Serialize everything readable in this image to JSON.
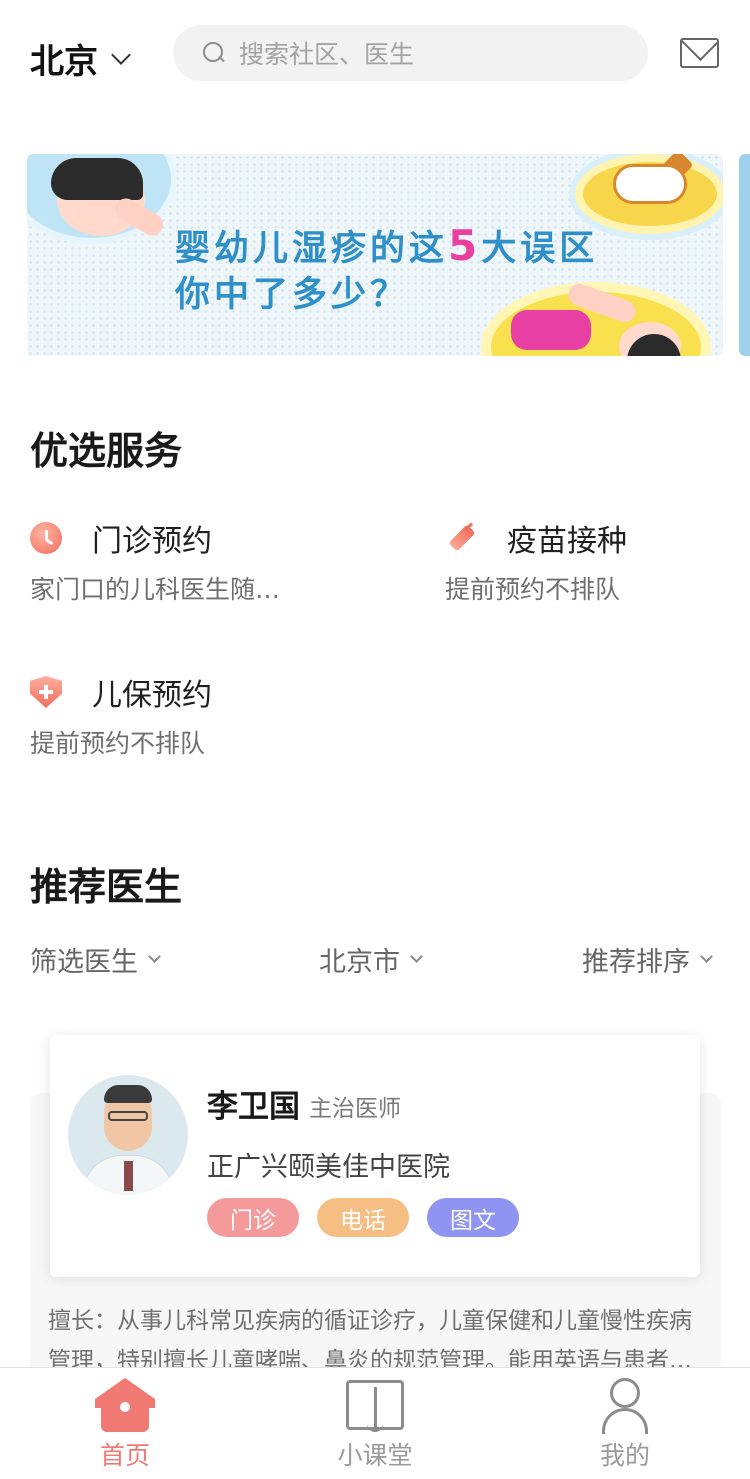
{
  "header": {
    "city": "北京",
    "search_placeholder": "搜索社区、医生"
  },
  "banner": {
    "line1_before": "婴幼儿湿疹的这",
    "line1_highlight": "5",
    "line1_after": "大误区",
    "line2": "你中了多少？"
  },
  "services": {
    "title": "优选服务",
    "items": [
      {
        "name": "门诊预约",
        "desc": "家门口的儿科医生随…",
        "icon": "clock-icon"
      },
      {
        "name": "疫苗接种",
        "desc": "提前预约不排队",
        "icon": "syringe-icon"
      },
      {
        "name": "儿保预约",
        "desc": "提前预约不排队",
        "icon": "shield-plus-icon"
      }
    ]
  },
  "doctors": {
    "title": "推荐医生",
    "filters": [
      {
        "label": "筛选医生"
      },
      {
        "label": "北京市"
      },
      {
        "label": "推荐排序"
      }
    ],
    "card": {
      "name": "李卫国",
      "title": "主治医师",
      "hospital": "正广兴颐美佳中医院",
      "tags": [
        "门诊",
        "电话",
        "图文"
      ],
      "specialty": "擅长：从事儿科常见疾病的循证诊疗，儿童保健和儿童慢性疾病管理，特别擅长儿童哮喘、鼻炎的规范管理。能用英语与患者…"
    }
  },
  "tabbar": {
    "tabs": [
      {
        "label": "首页",
        "active": true,
        "icon": "home-icon"
      },
      {
        "label": "小课堂",
        "active": false,
        "icon": "book-icon"
      },
      {
        "label": "我的",
        "active": false,
        "icon": "user-icon"
      }
    ]
  },
  "colors": {
    "accent": "#f07a73",
    "tag_clinic": "#f59a9a",
    "tag_phone": "#f5bf83",
    "tag_text": "#8f93f2",
    "banner_text": "#2e8fc9",
    "banner_highlight": "#ea3fa1"
  }
}
